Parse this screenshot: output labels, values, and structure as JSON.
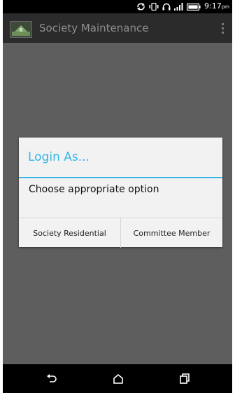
{
  "status_bar": {
    "time": "9:17",
    "ampm": "pm",
    "icons": [
      "sync-icon",
      "vibrate-icon",
      "headset-icon",
      "signal-icon",
      "battery-icon"
    ]
  },
  "action_bar": {
    "logo": "app-logo",
    "title": "Society Maintenance",
    "menu_icon": "overflow-menu-icon"
  },
  "dialog": {
    "title": "Login As...",
    "message": "Choose appropriate option",
    "buttons": [
      "Society Residential",
      "Committee Member"
    ]
  },
  "nav_bar": {
    "icons": [
      "back-icon",
      "home-icon",
      "recent-apps-icon"
    ]
  },
  "colors": {
    "accent": "#33b5e5",
    "overlay": "#5e5e5e",
    "action_bar": "#2b2b2b",
    "dialog_bg": "#f2f2f2"
  }
}
